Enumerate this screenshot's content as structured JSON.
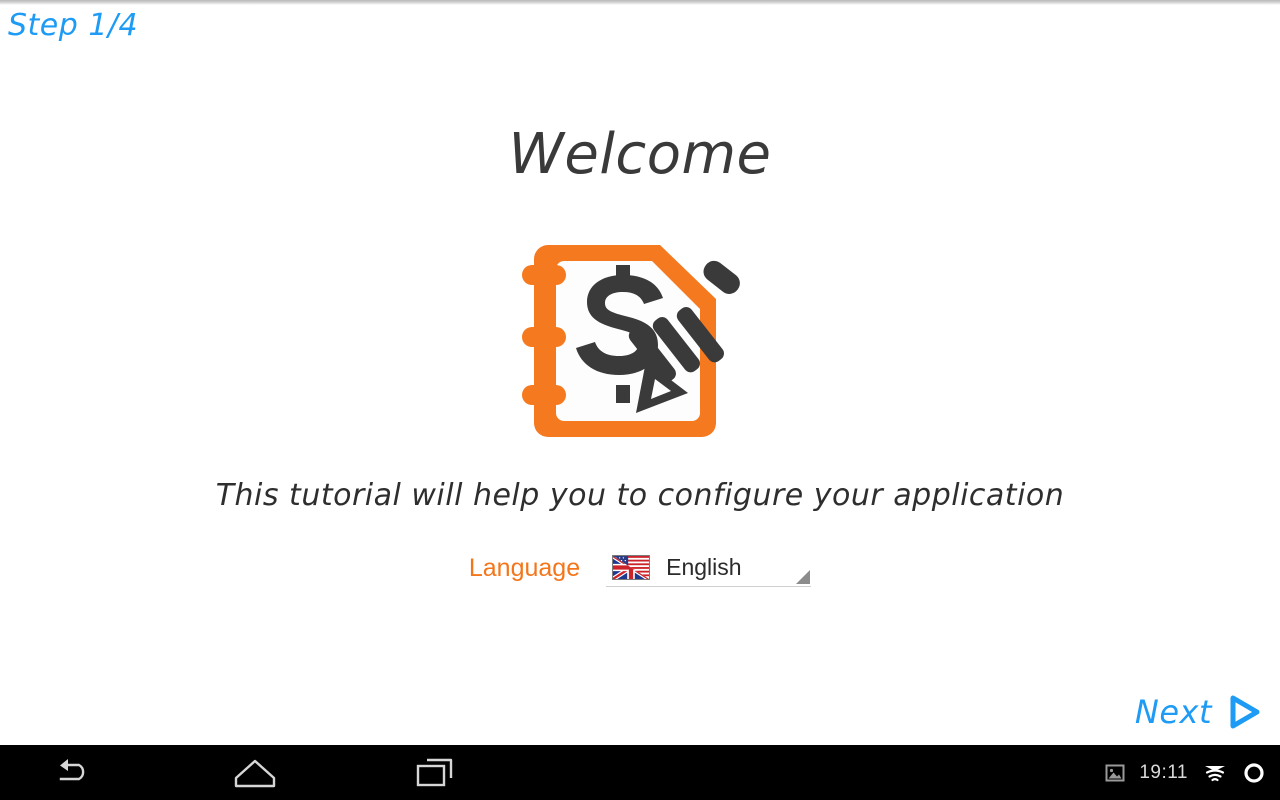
{
  "screen": {
    "background_color": "#ffffff",
    "accent_orange": "#f4761b",
    "accent_blue": "#1e9bf5",
    "text_dark": "#3a3a3a"
  },
  "header": {
    "step_label": "Step 1/4"
  },
  "main": {
    "title": "Welcome",
    "logo_icon_name": "notebook-dollar-pencil-logo",
    "subtitle": "This tutorial will help you to configure your application"
  },
  "language_selector": {
    "label": "Language",
    "flag_icon_name": "uk-us-flag-icon",
    "selected_value": "English",
    "caret_icon_name": "spinner-caret-icon"
  },
  "footer": {
    "next_label": "Next",
    "next_icon_name": "play-triangle-icon"
  },
  "navbar": {
    "back_icon_name": "back-arrow-icon",
    "home_icon_name": "home-icon",
    "recents_icon_name": "recents-icon",
    "status": {
      "screenshot_icon_name": "image-icon",
      "time": "19:11",
      "wifi_icon_name": "wifi-icon",
      "battery_icon_name": "battery-circle-icon"
    }
  }
}
